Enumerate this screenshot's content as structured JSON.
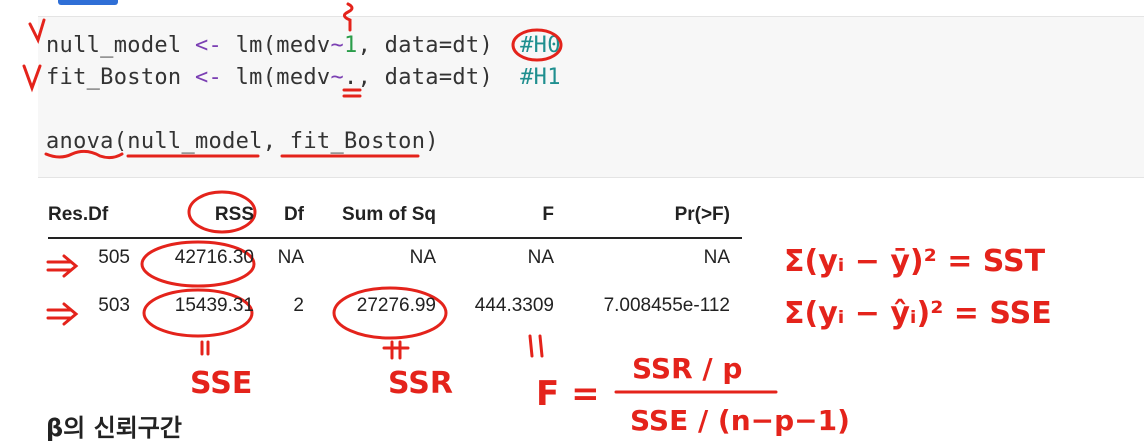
{
  "code": {
    "line1": {
      "lhs": "null_model",
      "assign": "<-",
      "call": "lm(medv",
      "tilde": "~",
      "rhs": "1",
      "rest": ", data=dt)",
      "comment": "#H0"
    },
    "line2": {
      "lhs": "fit_Boston",
      "assign": "<-",
      "call": "lm(medv",
      "tilde": "~",
      "rhs": ".",
      "rest": ", data=dt)",
      "comment": "#H1"
    },
    "line3": {
      "call": "anova(null_model, fit_Boston)"
    }
  },
  "anova_table": {
    "headers": [
      "Res.Df",
      "RSS",
      "Df",
      "Sum of Sq",
      "F",
      "Pr(>F)"
    ],
    "rows": [
      [
        "505",
        "42716.30",
        "NA",
        "NA",
        "NA",
        "NA"
      ],
      [
        "503",
        "15439.31",
        "2",
        "27276.99",
        "444.3309",
        "7.008455e-112"
      ]
    ]
  },
  "annotations": {
    "sse_label": "SSE",
    "ssr_label": "SSR",
    "eq_sst": "Σ(yᵢ − ȳ)² = SST",
    "eq_sse": "Σ(yᵢ − ŷᵢ)² = SSE",
    "f_lhs": "F =",
    "f_num": "SSR / p",
    "f_den": "SSE / (n−p−1)"
  },
  "section": {
    "title": "β의 신뢰구간"
  },
  "colors": {
    "annotation": "#e4231b",
    "comment": "#1f8f8f",
    "number": "#2a9d4a",
    "operator": "#7b3fb3"
  }
}
